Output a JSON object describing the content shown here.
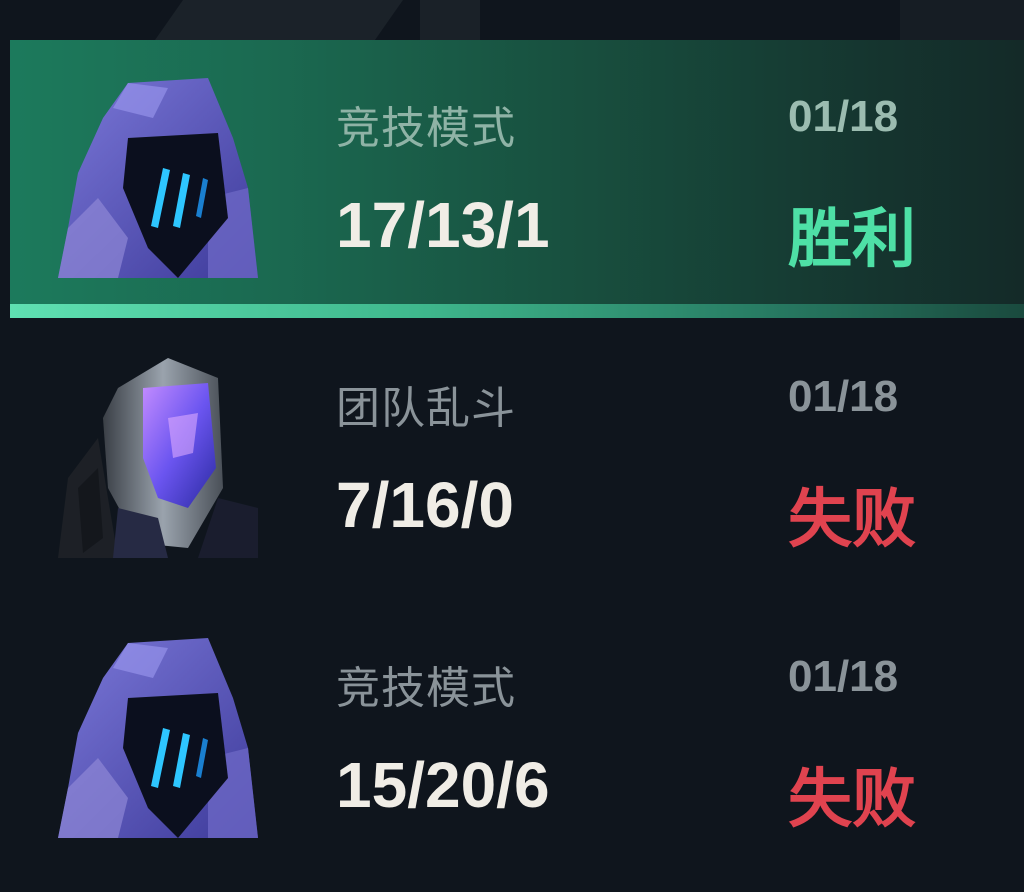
{
  "colors": {
    "win": "#4ee0a6",
    "loss": "#e0434f",
    "selected_bg": "#1c7a5c",
    "background": "#0f151d"
  },
  "matches": [
    {
      "selected": true,
      "avatar_icon": "hooded-hero-avatar-icon",
      "mode": "竞技模式",
      "date": "01/18",
      "kda": "17/13/1",
      "result": "胜利",
      "outcome": "win"
    },
    {
      "selected": false,
      "avatar_icon": "helmet-hero-avatar-icon",
      "mode": "团队乱斗",
      "date": "01/18",
      "kda": "7/16/0",
      "result": "失败",
      "outcome": "loss"
    },
    {
      "selected": false,
      "avatar_icon": "hooded-hero-avatar-icon",
      "mode": "竞技模式",
      "date": "01/18",
      "kda": "15/20/6",
      "result": "失败",
      "outcome": "loss"
    }
  ]
}
